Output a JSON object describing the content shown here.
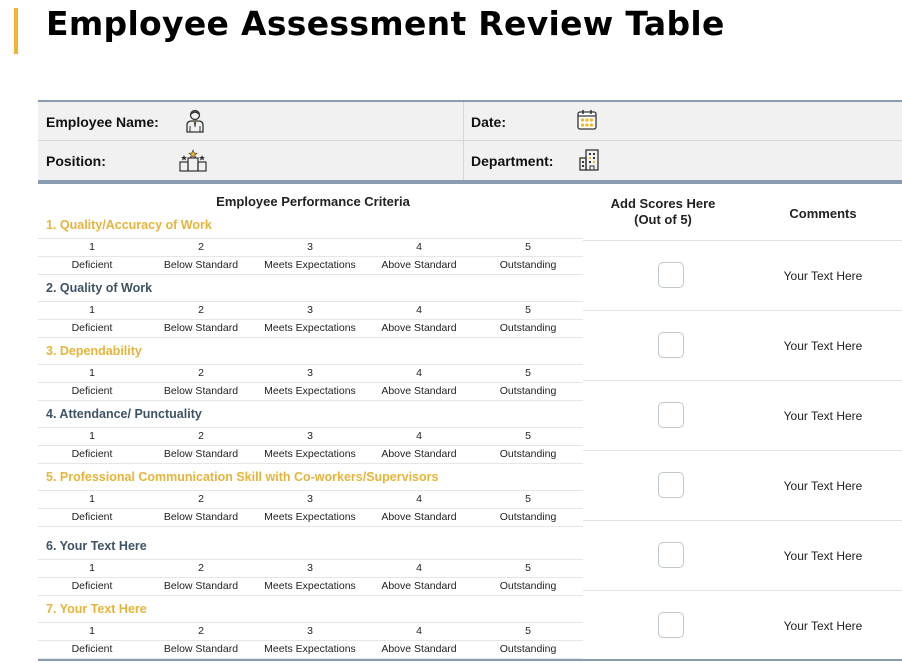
{
  "page": {
    "title": "Employee Assessment Review Table"
  },
  "info": {
    "employee_name_label": "Employee Name:",
    "position_label": "Position:",
    "date_label": "Date:",
    "department_label": "Department:"
  },
  "table": {
    "criteria_header": "Employee Performance Criteria",
    "score_header_line1": "Add Scores Here",
    "score_header_line2": "(Out of 5)",
    "comments_header": "Comments",
    "scale_numbers": [
      "1",
      "2",
      "3",
      "4",
      "5"
    ],
    "scale_levels": [
      "Deficient",
      "Below Standard",
      "Meets Expectations",
      "Above Standard",
      "Outstanding"
    ],
    "criteria": [
      {
        "name": "1. Quality/Accuracy of Work",
        "color": "#e6b43a"
      },
      {
        "name": "2. Quality of Work",
        "color": "#3f5366"
      },
      {
        "name": "3. Dependability",
        "color": "#e6b43a"
      },
      {
        "name": "4. Attendance/ Punctuality",
        "color": "#3f5366"
      },
      {
        "name": "5. Professional Communication Skill with Co-workers/Supervisors",
        "color": "#e6b43a"
      },
      {
        "name": "6. Your Text Here",
        "color": "#3f5366"
      },
      {
        "name": "7. Your Text Here",
        "color": "#e6b43a"
      }
    ],
    "comments": [
      "Your Text Here",
      "Your Text Here",
      "Your Text Here",
      "Your Text Here",
      "Your Text Here",
      "Your Text Here"
    ]
  },
  "icons": {
    "employee": "employee-icon",
    "position": "podium-icon",
    "date": "calendar-icon",
    "department": "building-icon"
  }
}
